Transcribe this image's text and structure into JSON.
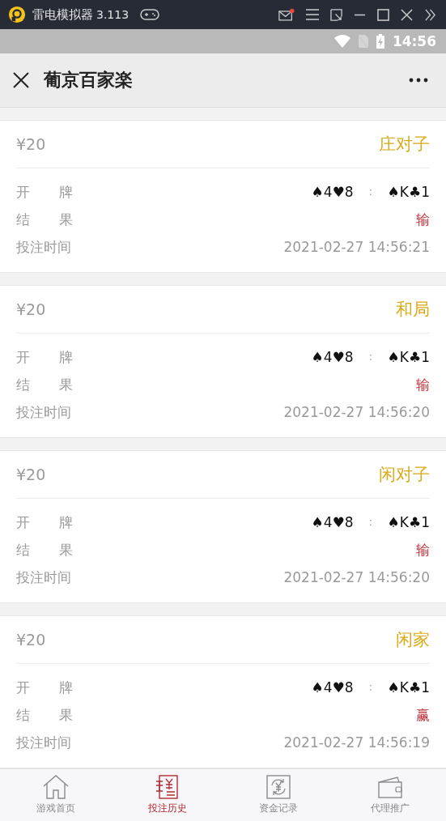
{
  "emulator_bar": {
    "title": "雷电模拟器",
    "version": "3.113"
  },
  "status_bar": {
    "time": "14:56"
  },
  "header": {
    "title": "葡京百家楽"
  },
  "bets": [
    {
      "amount": "¥20",
      "bet_type": "庄对子",
      "cards_label": "开 牌",
      "cards_left": "♠4♥8",
      "separator": "：",
      "cards_right": "♠K♣1",
      "result_label": "结 果",
      "result": "输",
      "time_label": "投注时间",
      "time": "2021-02-27 14:56:21"
    },
    {
      "amount": "¥20",
      "bet_type": "和局",
      "cards_label": "开 牌",
      "cards_left": "♠4♥8",
      "separator": "：",
      "cards_right": "♠K♣1",
      "result_label": "结 果",
      "result": "输",
      "time_label": "投注时间",
      "time": "2021-02-27 14:56:20"
    },
    {
      "amount": "¥20",
      "bet_type": "闲对子",
      "cards_label": "开 牌",
      "cards_left": "♠4♥8",
      "separator": "：",
      "cards_right": "♠K♣1",
      "result_label": "结 果",
      "result": "输",
      "time_label": "投注时间",
      "time": "2021-02-27 14:56:20"
    },
    {
      "amount": "¥20",
      "bet_type": "闲家",
      "cards_label": "开 牌",
      "cards_left": "♠4♥8",
      "separator": "：",
      "cards_right": "♠K♣1",
      "result_label": "结 果",
      "result": "赢",
      "time_label": "投注时间",
      "time": "2021-02-27 14:56:19"
    }
  ],
  "tabs": [
    {
      "label": "游戏首页",
      "kind": "home",
      "selected": false
    },
    {
      "label": "投注历史",
      "kind": "ledger",
      "selected": true
    },
    {
      "label": "资金记录",
      "kind": "exchange",
      "selected": false
    },
    {
      "label": "代理推广",
      "kind": "wallet",
      "selected": false
    }
  ]
}
